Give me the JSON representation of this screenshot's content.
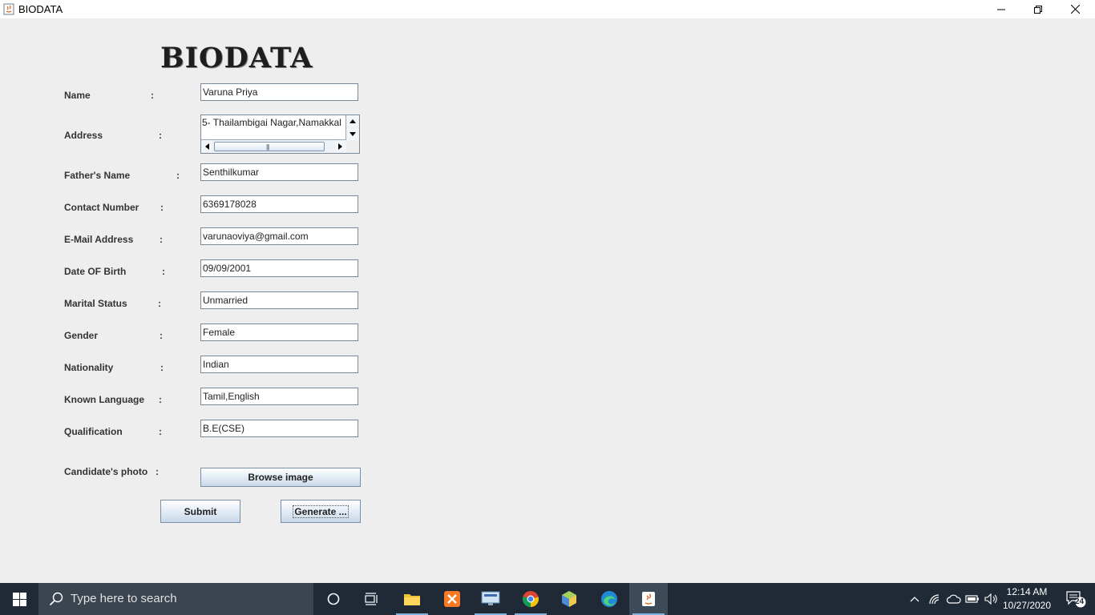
{
  "window": {
    "title": "BIODATA"
  },
  "form": {
    "heading": "BIODATA",
    "fields": [
      {
        "label": "Name",
        "value": "Varuna Priya"
      },
      {
        "label": "Address",
        "value": "5- Thailambigai Nagar,Namakkal"
      },
      {
        "label": "Father's Name",
        "value": "Senthilkumar"
      },
      {
        "label": "Contact Number",
        "value": "6369178028"
      },
      {
        "label": "E-Mail Address",
        "value": "varunaoviya@gmail.com"
      },
      {
        "label": "Date OF Birth",
        "value": "09/09/2001"
      },
      {
        "label": "Marital Status",
        "value": "Unmarried"
      },
      {
        "label": "Gender",
        "value": "Female"
      },
      {
        "label": "Nationality",
        "value": "Indian"
      },
      {
        "label": "Known Language",
        "value": "Tamil,English"
      },
      {
        "label": "Qualification",
        "value": "B.E(CSE)"
      }
    ],
    "photo_label": "Candidate's photo",
    "colon": ":",
    "browse_label": "Browse image",
    "submit_label": "Submit",
    "generate_label": "Generate ..."
  },
  "taskbar": {
    "search_placeholder": "Type here to search",
    "time": "12:14 AM",
    "date": "10/27/2020",
    "notification_count": "24"
  },
  "colors": {
    "taskbar_bg": "#1f2a36",
    "button_border": "#7a8ea4",
    "field_border": "#7a8a99"
  }
}
